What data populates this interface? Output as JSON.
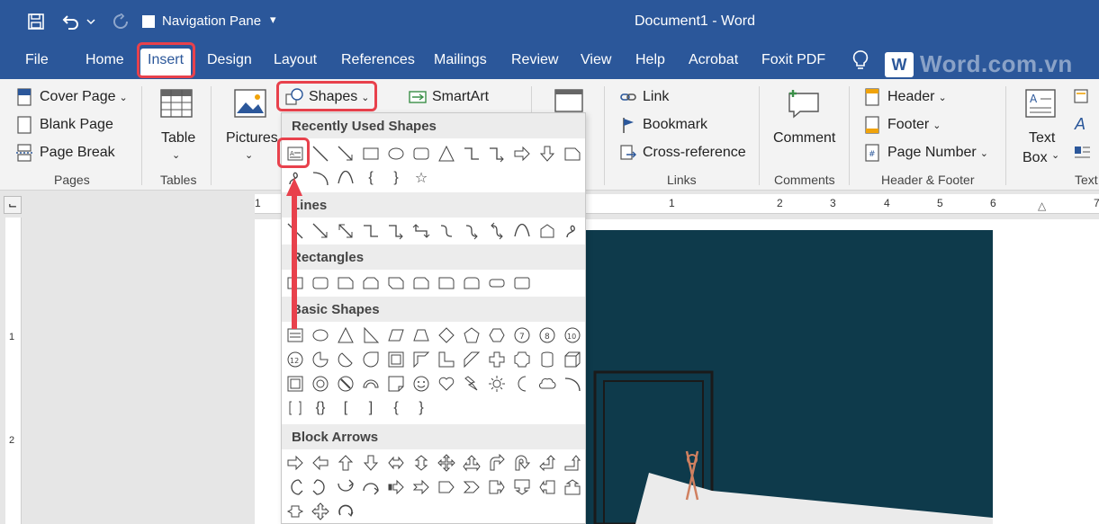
{
  "titlebar": {
    "qat_label": "Navigation Pane",
    "doc_title": "Document1  -  Word"
  },
  "tabs": [
    "File",
    "Home",
    "Insert",
    "Design",
    "Layout",
    "References",
    "Mailings",
    "Review",
    "View",
    "Help",
    "Acrobat",
    "Foxit PDF"
  ],
  "active_tab": "Insert",
  "watermark": "Word.com.vn",
  "ribbon": {
    "pages": {
      "cover_page": "Cover Page",
      "blank_page": "Blank Page",
      "page_break": "Page Break",
      "label": "Pages"
    },
    "tables": {
      "table": "Table",
      "label": "Tables"
    },
    "illustrations": {
      "pictures": "Pictures",
      "shapes": "Shapes",
      "smartart": "SmartArt"
    },
    "links": {
      "link": "Link",
      "bookmark": "Bookmark",
      "cross_reference": "Cross-reference",
      "label": "Links"
    },
    "comments": {
      "comment": "Comment",
      "label": "Comments"
    },
    "header_footer": {
      "header": "Header",
      "footer": "Footer",
      "page_number": "Page Number",
      "label": "Header & Footer"
    },
    "text": {
      "text_box_1": "Text",
      "text_box_2": "Box",
      "label": "Text"
    }
  },
  "ruler": {
    "numbers": [
      "1",
      "1",
      "2",
      "3",
      "4",
      "5",
      "6",
      "7"
    ],
    "v_numbers": [
      "1",
      "2"
    ]
  },
  "shapes_menu": {
    "sections": [
      "Recently Used Shapes",
      "Lines",
      "Rectangles",
      "Basic Shapes",
      "Block Arrows"
    ]
  },
  "colors": {
    "accent": "#2b579a",
    "highlight": "#e8414c"
  }
}
